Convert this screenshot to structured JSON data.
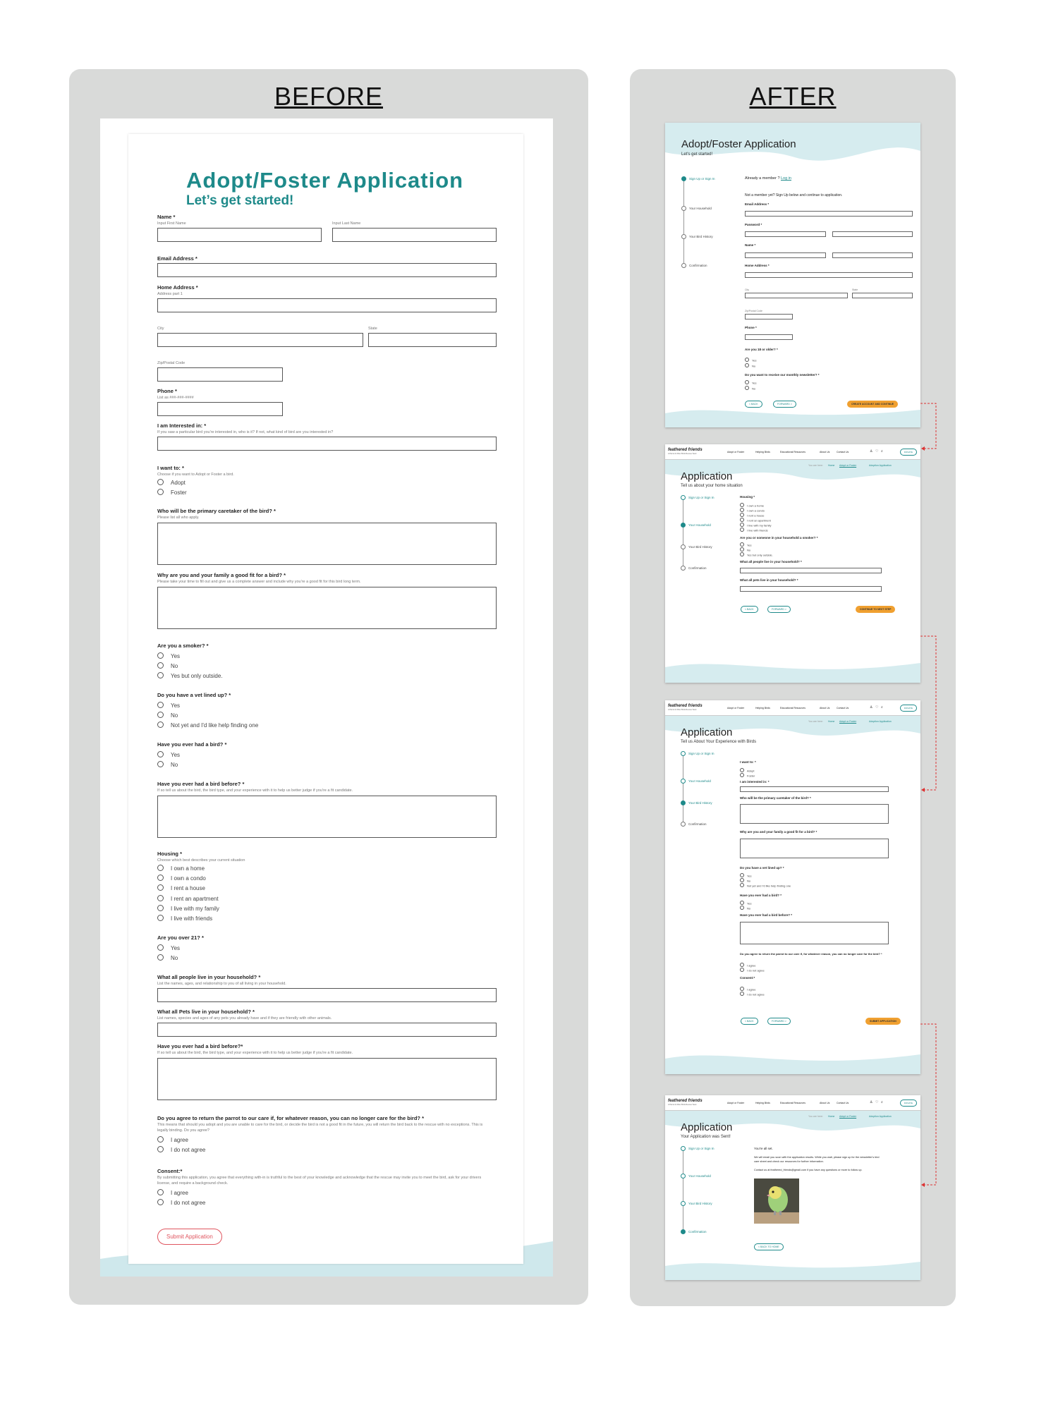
{
  "before": {
    "heading": "BEFORE",
    "title": "Adopt/Foster Application",
    "subtitle": "Let’s get started!",
    "name_label": "Name *",
    "first_hint": "Input First Name",
    "last_hint": "Input Last Name",
    "email_label": "Email Address *",
    "home_label": "Home Address *",
    "addr_hint": "Address part 1",
    "city": "City",
    "state": "State",
    "zip": "Zip/Postal Code",
    "phone_label": "Phone *",
    "phone_hint": "List as ###-###-####",
    "interest_label": "I am Interested in: *",
    "interest_hint": "If you saw a particular bird you're interested in, who is it? If not, what kind of bird are you interested in?",
    "want_label": "I want to: *",
    "want_hint": "Choose if you want to Adopt or Foster a bird.",
    "want_opts": [
      "Adopt",
      "Foster"
    ],
    "caretaker_label": "Who will be the primary caretaker of the bird? *",
    "caretaker_hint": "Please list all who apply.",
    "fit_label": "Why are you and your family a good fit for a bird? *",
    "fit_hint": "Please take your time to fill out and give us a complete answer and include why you're a good fit for this bird long term.",
    "smoker_label": "Are you a smoker? *",
    "smoker_opts": [
      "Yes",
      "No",
      "Yes but only outside."
    ],
    "vet_label": "Do you have a vet lined up? *",
    "vet_opts": [
      "Yes",
      "No",
      "Not yet and I'd like help finding one"
    ],
    "hadbird_label": "Have you ever had a bird? *",
    "hadbird_opts": [
      "Yes",
      "No"
    ],
    "before_label": "Have you ever had a bird before? *",
    "before_hint": "If so tell us about the bird, the bird type, and your experience with it to help us better judge if you're a fit candidate.",
    "housing_label": "Housing *",
    "housing_hint": "Choose which best describes your current situation",
    "housing_opts": [
      "I own a home",
      "I own a condo",
      "I rent a house",
      "I rent an apartment",
      "I live with my family",
      "I live with friends"
    ],
    "over21_label": "Are you over 21? *",
    "over21_opts": [
      "Yes",
      "No"
    ],
    "people_label": "What all people live in your household? *",
    "people_hint": "List the names, ages, and relationship to you of all living in your household.",
    "pets_label": "What all Pets live in your household? *",
    "pets_hint": "List names, species and ages of any pets you already have and if they are friendly with other animals.",
    "before2_label": "Have you ever had a bird before?*",
    "before2_hint": "If so tell us about the bird, the bird type, and your experience with it to help us better judge if you're a fit candidate.",
    "return_label": "Do you agree to return the parrot to our care if, for whatever reason, you can no longer care for the bird? *",
    "return_hint1": "This means that should you adopt and you are unable to care for the bird, or decide the bird is not a good fit in the future, you will return the bird back to the rescue with no exceptions. This is",
    "return_hint2": "legally binding. Do you agree?",
    "agree_opts": [
      "I agree",
      "I do not agree"
    ],
    "consent_label": "Consent:*",
    "consent_hint1": "By submitting this application, you agree that everything with-in is truthful to the best of your knowledge and acknowledge that the rescue may invite you to meet the bird, ask for your drivers",
    "consent_hint2": "license, and require a background check.",
    "submit": "Submit Application"
  },
  "after": {
    "heading": "AFTER",
    "s1": {
      "title": "Adopt/Foster Application",
      "sub": "Let's get started!",
      "member": "Already a member ?",
      "login": "Log in",
      "notmember": "Not a member yet? Sign Up below and continue to application.",
      "email": "Email Address *",
      "pw": "Password *",
      "name": "Name *",
      "home": "Home Address *",
      "city": "City",
      "state": "State",
      "zip": "Zip/Postal Code",
      "phone": "Phone *",
      "age": "Are you 18 or older? *",
      "news": "Do you want to receive our monthly newsletter? *",
      "yn": [
        "Yes",
        "No"
      ],
      "create": "CREATE ACCOUNT AND CONTINUE"
    },
    "steps": [
      "Sign Up or Sign In",
      "Your Household",
      "Your Bird History",
      "Confirmation"
    ],
    "nav": {
      "logo": "feathered friends",
      "tagline": "A Parrot & Other Birds Rescue Team",
      "links": [
        "Adopt or Foster",
        "Helping Birds",
        "Educational Resources",
        "About Us",
        "Contact Us"
      ],
      "donate": "DONATE"
    },
    "crumbs": {
      "here": "You are here:",
      "home": "Home",
      "adopt": "Adopt or Foster",
      "app": "Adoption Application"
    },
    "s2": {
      "title": "Application",
      "sub": "Tell us about your home situation",
      "housing": "Housing *",
      "housing_opts": [
        "I own a home",
        "I own a condo",
        "I rent a house",
        "I rent an apartment",
        "I live with my family",
        "I live with friends"
      ],
      "smoker": "Are you or someone in your household a smoker? *",
      "smoker_opts": [
        "Yes",
        "No",
        "Yes but only outside."
      ],
      "people": "What all people live in your household? *",
      "pets": "What all pets live in your household? *",
      "cont": "CONTINUE TO NEXT STEP"
    },
    "s3": {
      "title": "Application",
      "sub": "Tell us About Your Experience with Birds",
      "want": "I want to: *",
      "want_opts": [
        "Adopt",
        "Foster"
      ],
      "interest": "I am interested in: *",
      "caretaker": "Who will be the primary caretaker of the bird? *",
      "fit": "Why are you and your family a good fit for a bird? *",
      "vet": "Do you have a vet lined up? *",
      "vet_opts": [
        "Yes",
        "No",
        "Not yet and I'd like help finding one"
      ],
      "hadbird": "Have you ever had a bird? *",
      "hadbird_opts": [
        "Yes",
        "No"
      ],
      "before": "Have you ever had a bird before? *",
      "return": "Do you agree to return the parrot to our care if, for whatever reason, you can no longer care for the bird? *",
      "consent": "Consent:*",
      "agree_opts": [
        "I agree",
        "I do not agree"
      ],
      "submit": "SUBMIT APPLICATION"
    },
    "s4": {
      "title": "Application",
      "sub": "Your Application was Sent!",
      "allset": "You're all set.",
      "line1": "We will email you soon with the application results.  While you wait, please sign up for the newsletter's bird",
      "line2": "care sheet and check our resources for further information.",
      "line3": "Contact us at feathered_friends@gmail.com if you have any questions or more to follow up.",
      "home": "< BACK TO HOME"
    },
    "back": "< BACK",
    "fwd": "FORWARD >"
  }
}
